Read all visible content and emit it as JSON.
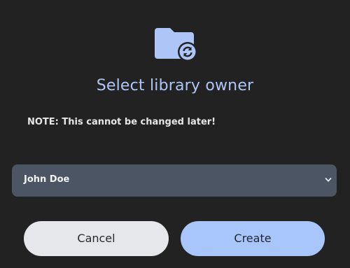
{
  "dialog": {
    "icon": "folder-sync-icon",
    "title": "Select library owner",
    "note": "NOTE: This cannot be changed later!",
    "owner_select": {
      "selected": "John Doe",
      "icon": "chevron-down-icon"
    },
    "cancel_label": "Cancel",
    "create_label": "Create"
  },
  "colors": {
    "background": "#222222",
    "accent": "#aec6f7",
    "select_bg": "#4b5563",
    "cancel_bg": "#e6e7ea",
    "create_bg": "#a8c6fa"
  }
}
